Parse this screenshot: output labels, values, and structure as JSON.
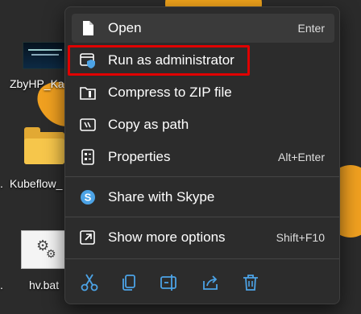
{
  "desktop": {
    "icons": [
      {
        "label": "ZbyHP_Ka"
      },
      {
        "label": "Kubeflow_"
      },
      {
        "label": "hv.bat"
      }
    ],
    "truncation_marks": [
      ".",
      "."
    ]
  },
  "menu": {
    "items": [
      {
        "label": "Open",
        "shortcut": "Enter",
        "icon": "file-icon"
      },
      {
        "label": "Run as administrator",
        "shortcut": "",
        "icon": "shield-window-icon"
      },
      {
        "label": "Compress to ZIP file",
        "shortcut": "",
        "icon": "zip-folder-icon"
      },
      {
        "label": "Copy as path",
        "shortcut": "",
        "icon": "path-icon"
      },
      {
        "label": "Properties",
        "shortcut": "Alt+Enter",
        "icon": "properties-icon"
      },
      {
        "label": "Share with Skype",
        "shortcut": "",
        "icon": "skype-icon"
      },
      {
        "label": "Show more options",
        "shortcut": "Shift+F10",
        "icon": "more-options-icon"
      }
    ],
    "toolbar": [
      "cut-icon",
      "copy-icon",
      "rename-icon",
      "share-icon",
      "delete-icon"
    ],
    "accent_color": "#4ca3e6",
    "highlight_color": "#e00000"
  }
}
